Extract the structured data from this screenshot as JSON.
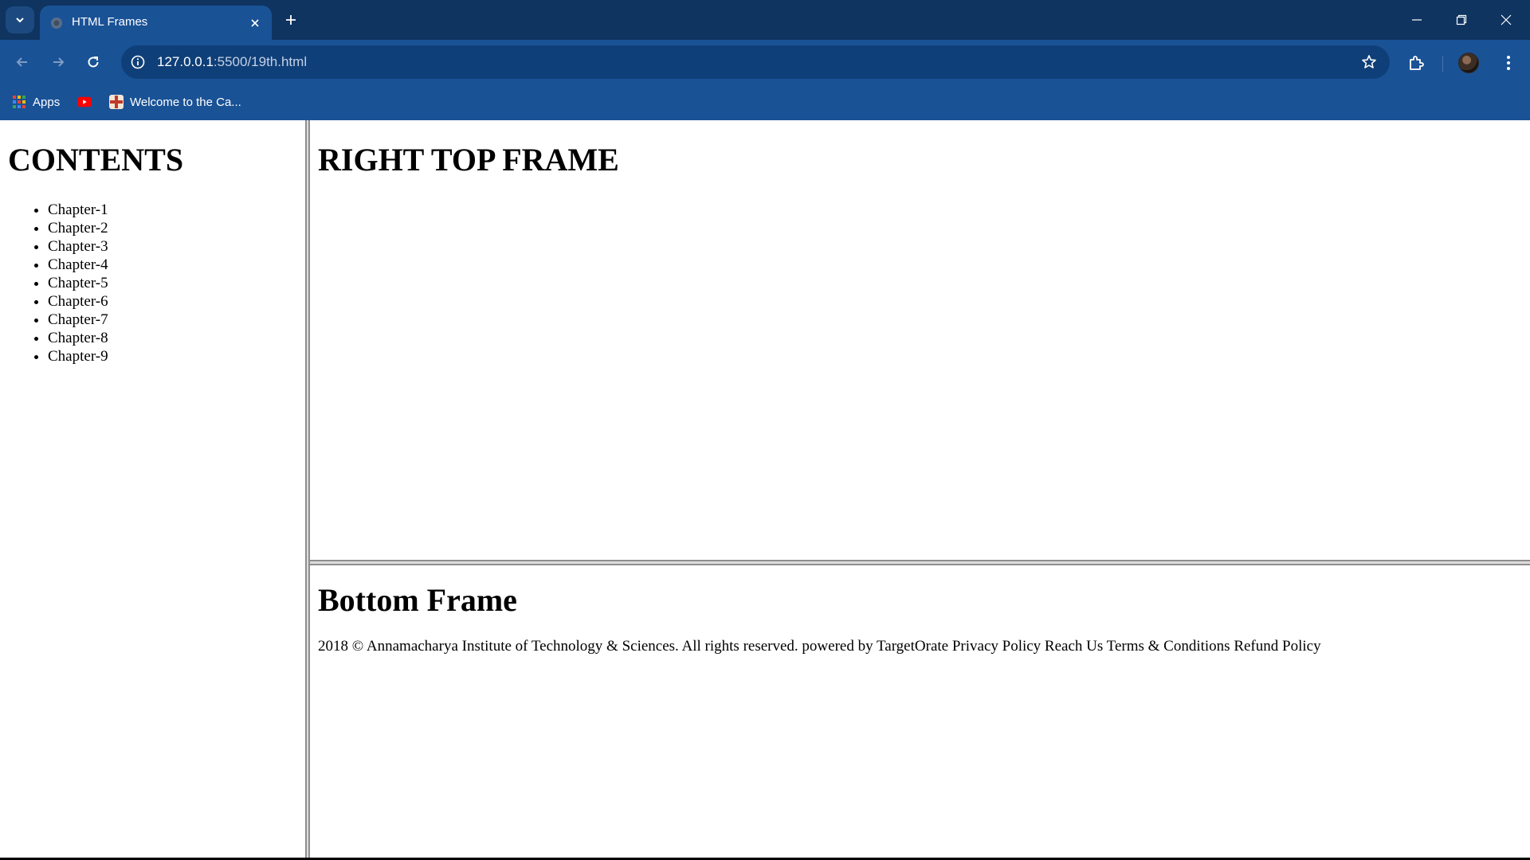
{
  "browser": {
    "tab": {
      "title": "HTML Frames"
    },
    "url": {
      "host": "127.0.0.1",
      "rest": ":5500/19th.html"
    },
    "bookmarks": [
      {
        "label": "Apps",
        "icon": "apps-grid-icon"
      },
      {
        "label": "",
        "icon": "youtube-icon"
      },
      {
        "label": "Welcome to the Ca...",
        "icon": "site-favicon-icon"
      }
    ]
  },
  "frames": {
    "left": {
      "heading": "CONTENTS",
      "chapters": [
        "Chapter-1",
        "Chapter-2",
        "Chapter-3",
        "Chapter-4",
        "Chapter-5",
        "Chapter-6",
        "Chapter-7",
        "Chapter-8",
        "Chapter-9"
      ]
    },
    "right_top": {
      "heading": "RIGHT TOP FRAME"
    },
    "bottom": {
      "heading": "Bottom Frame",
      "footer": "2018 © Annamacharya Institute of Technology & Sciences. All rights reserved. powered by TargetOrate Privacy Policy Reach Us Terms & Conditions Refund Policy"
    }
  },
  "colors": {
    "tabbar": "#0f3460",
    "toolbar": "#1a5296",
    "omnibox": "#0f3f78"
  }
}
